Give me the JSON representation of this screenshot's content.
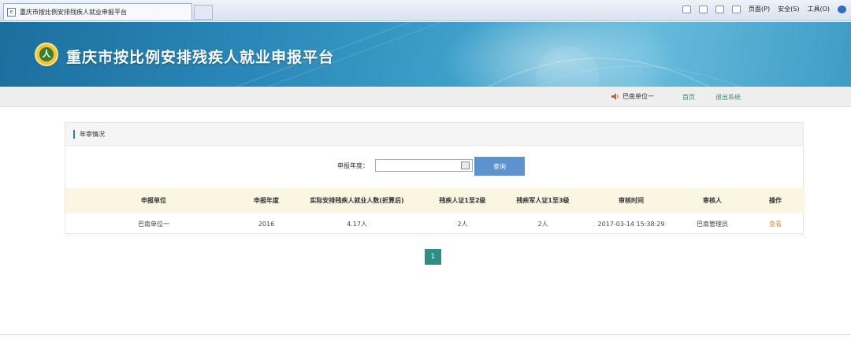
{
  "browser": {
    "tab_title": "重庆市按比例安排残疾人就业申报平台",
    "commands": [
      "页面(P)",
      "安全(S)",
      "工具(O)"
    ]
  },
  "site": {
    "title": "重庆市按比例安排残疾人就业申报平台"
  },
  "user_bar": {
    "unit": "巴南单位一",
    "home": "首页",
    "logout": "退出系统"
  },
  "panel": {
    "title": "年审情况",
    "search_label": "申报年度：",
    "search_value": "",
    "query_button": "查询"
  },
  "table": {
    "columns": [
      "申报单位",
      "申报年度",
      "实际安排残疾人就业人数(折算后)",
      "残疾人证1至2级",
      "残疾军人证1至3级",
      "审核时间",
      "审核人",
      "操作"
    ],
    "rows": [
      {
        "unit": "巴南单位一",
        "year": "2016",
        "employed": "4.17人",
        "level12": "2人",
        "military13": "2人",
        "review_time": "2017-03-14 15:38:29",
        "reviewer": "巴南管理员",
        "action": "查看"
      }
    ]
  },
  "pagination": {
    "current": "1"
  }
}
